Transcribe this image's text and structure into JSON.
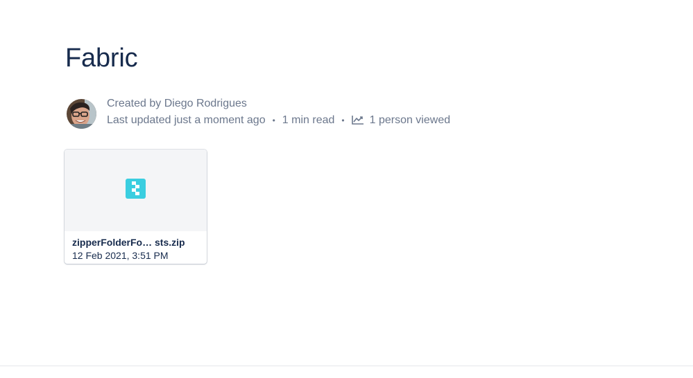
{
  "page": {
    "title": "Fabric"
  },
  "byline": {
    "created_by": "Created by Diego Rodrigues",
    "last_updated": "Last updated just a moment ago",
    "read_time": "1 min read",
    "views": "1 person viewed",
    "separator": "•",
    "views_icon": "line-chart-icon"
  },
  "attachment": {
    "file_name": "zipperFolderFo… sts.zip",
    "date": "12 Feb 2021, 3:51 PM",
    "icon": "zip-file-icon",
    "icon_color": "#3acee0"
  },
  "colors": {
    "title": "#172b4d",
    "meta_text": "#6b778c",
    "preview_bg": "#f4f5f7"
  }
}
